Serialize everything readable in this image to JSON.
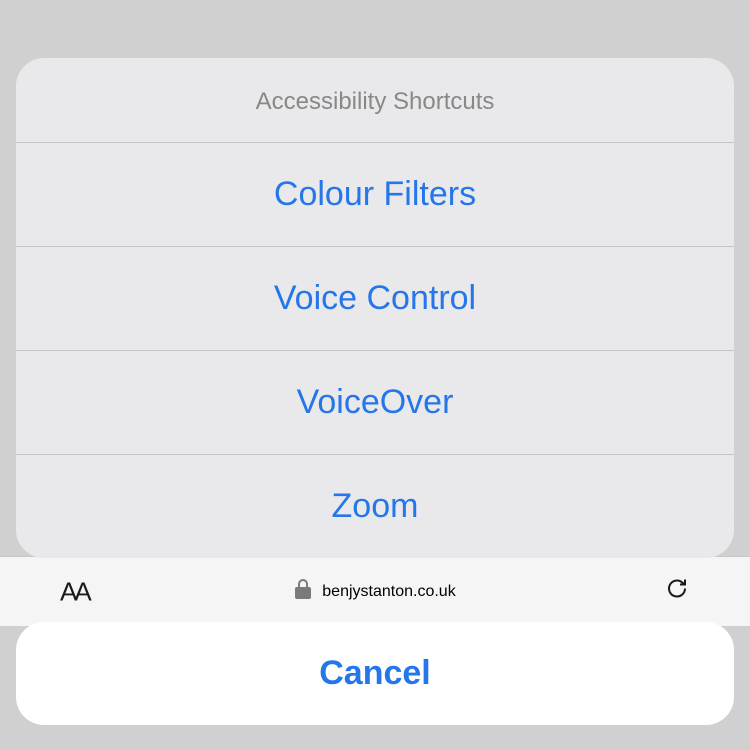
{
  "sheet": {
    "title": "Accessibility Shortcuts",
    "options": {
      "0": "Colour Filters",
      "1": "Voice Control",
      "2": "VoiceOver",
      "3": "Zoom"
    },
    "cancel": "Cancel"
  },
  "background": {
    "textIcon": "AA",
    "url": "benjystanton.co.uk"
  }
}
